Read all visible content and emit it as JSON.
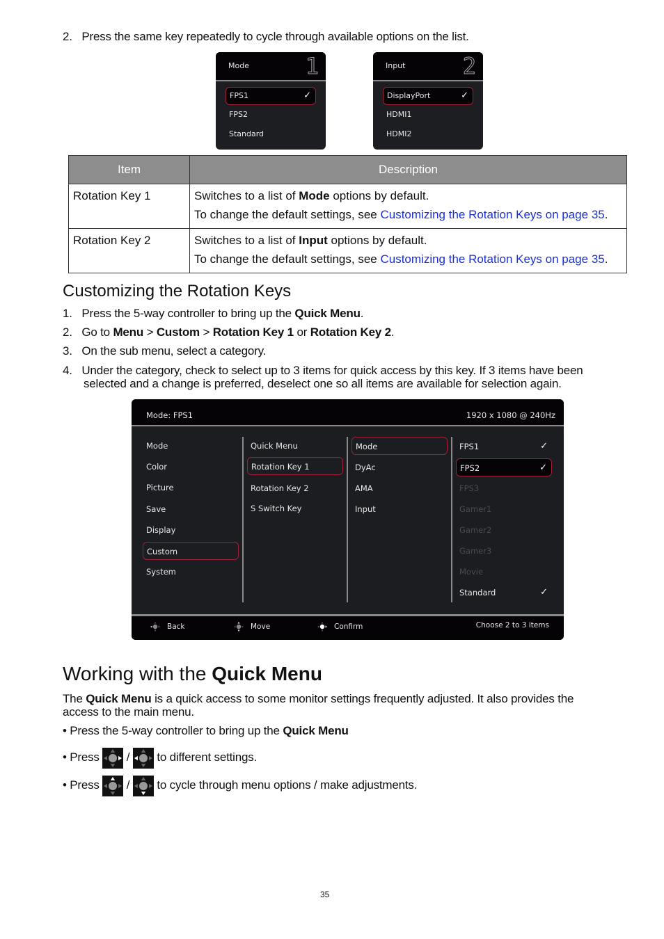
{
  "step2_intro": {
    "num": "2.",
    "text": "Press the same key repeatedly to cycle through available options on the list."
  },
  "popup_mode": {
    "title": "Mode",
    "key_number": "1",
    "options": [
      {
        "label": "FPS1",
        "selected": true,
        "checked": true
      },
      {
        "label": "FPS2",
        "selected": false,
        "checked": false
      },
      {
        "label": "Standard",
        "selected": false,
        "checked": false
      }
    ]
  },
  "popup_input": {
    "title": "Input",
    "key_number": "2",
    "options": [
      {
        "label": "DisplayPort",
        "selected": true,
        "checked": true
      },
      {
        "label": "HDMI1",
        "selected": false,
        "checked": false
      },
      {
        "label": "HDMI2",
        "selected": false,
        "checked": false
      }
    ]
  },
  "check_glyph": "✓",
  "table": {
    "headers": [
      "Item",
      "Description"
    ],
    "rows": [
      {
        "item": "Rotation Key 1",
        "desc_pre": "Switches to a list of ",
        "desc_bold": "Mode",
        "desc_post": " options by default.",
        "line2_pre": "To change the default settings, see ",
        "line2_link": "Customizing the Rotation Keys on page 35",
        "line2_post": "."
      },
      {
        "item": "Rotation Key 2",
        "desc_pre": "Switches to a list of ",
        "desc_bold": "Input",
        "desc_post": " options by default.",
        "line2_pre": "To change the default settings, see ",
        "line2_link": "Customizing the Rotation Keys on page 35",
        "line2_post": "."
      }
    ]
  },
  "customizing": {
    "heading": "Customizing the Rotation Keys",
    "steps": [
      {
        "num": "1.",
        "pre": "Press the 5-way controller to bring up the ",
        "b1": "Quick Menu",
        "post": "."
      },
      {
        "num": "2.",
        "pre": "Go to ",
        "b1": "Menu",
        "sep1": " > ",
        "b2": "Custom",
        "sep2": " > ",
        "b3": "Rotation Key 1",
        "sep3": " or ",
        "b4": "Rotation Key 2",
        "post": "."
      },
      {
        "num": "3.",
        "text": "On the sub menu, select a category."
      },
      {
        "num": "4.",
        "line1": "Under the category, check to select up to 3 items for quick access by this key. If 3 items have been",
        "line2": "selected and a change is preferred, deselect one so all items are available for selection again."
      }
    ]
  },
  "osd": {
    "top_left": "Mode: FPS1",
    "top_right": "1920 x 1080 @ 240Hz",
    "col1": [
      "Mode",
      "Color",
      "Picture",
      "Save",
      "Display",
      "Custom",
      "System"
    ],
    "col1_selected": "Custom",
    "col2": [
      "Quick Menu",
      "Rotation Key 1",
      "Rotation Key 2",
      "S Switch Key"
    ],
    "col2_selected": "Rotation Key 1",
    "col3": [
      "Mode",
      "DyAc",
      "AMA",
      "Input"
    ],
    "col3_selected": "Mode",
    "col4": [
      {
        "label": "FPS1",
        "checked": true,
        "enabled": true
      },
      {
        "label": "FPS2",
        "checked": true,
        "enabled": true
      },
      {
        "label": "FPS3",
        "checked": false,
        "enabled": false
      },
      {
        "label": "Gamer1",
        "checked": false,
        "enabled": false
      },
      {
        "label": "Gamer2",
        "checked": false,
        "enabled": false
      },
      {
        "label": "Gamer3",
        "checked": false,
        "enabled": false
      },
      {
        "label": "Movie",
        "checked": false,
        "enabled": false
      },
      {
        "label": "Standard",
        "checked": true,
        "enabled": true
      }
    ],
    "col4_selected": "FPS2",
    "footer": {
      "back": "Back",
      "move": "Move",
      "confirm": "Confirm",
      "hint": "Choose 2 to 3 items"
    }
  },
  "quick_menu": {
    "heading_pre": "Working with the ",
    "heading_bold": "Quick Menu",
    "para_pre": "The ",
    "para_bold": "Quick Menu",
    "para_line1_post": " is a quick access to some monitor settings frequently adjusted. It also provides the",
    "para_line2": "access to the main menu.",
    "bullets": [
      {
        "pre": "• Press the 5-way controller to bring up the ",
        "bold": "Quick Menu"
      },
      {
        "pre": "• Press ",
        "sep": " / ",
        "post": " to different settings.",
        "icons": [
          "controller-left-right-icon",
          "controller-left-right-icon"
        ]
      },
      {
        "pre": "• Press ",
        "sep": " / ",
        "post": " to cycle through menu options / make adjustments.",
        "icons": [
          "controller-up-icon",
          "controller-down-icon"
        ]
      }
    ]
  },
  "page_number": "35"
}
